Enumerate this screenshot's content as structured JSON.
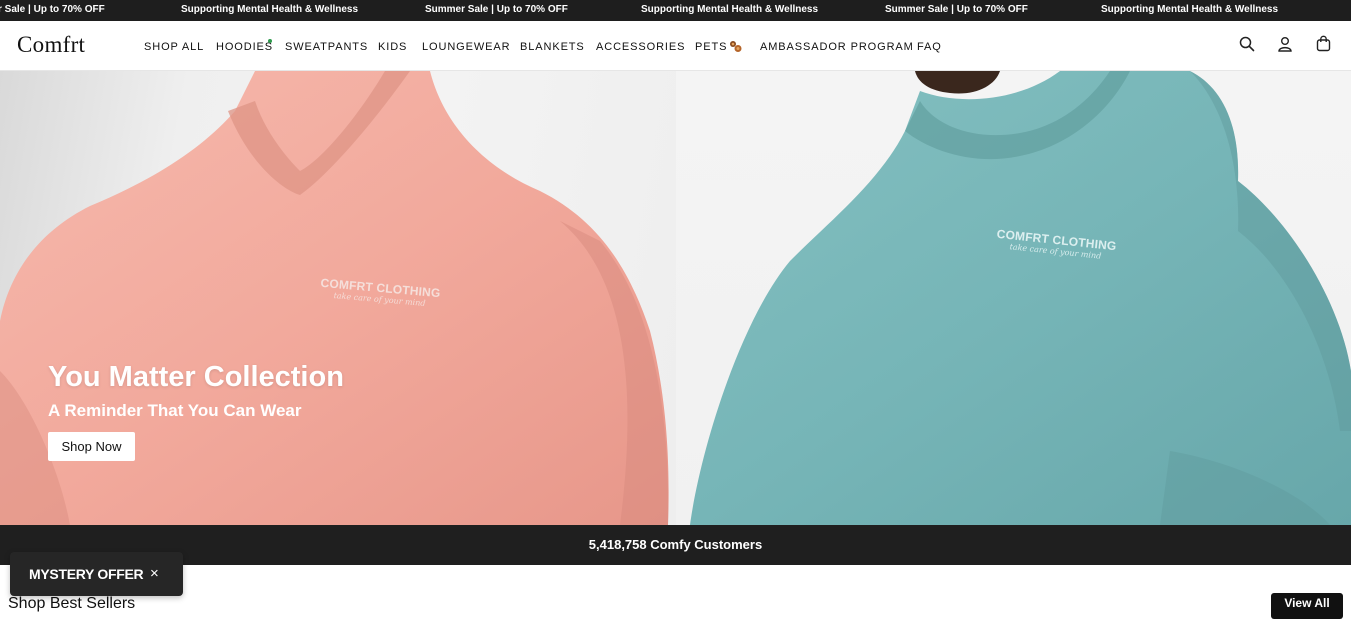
{
  "ticker": {
    "items": [
      "r Sale | Up to 70% OFF",
      "Supporting Mental Health & Wellness",
      "Summer Sale | Up to 70% OFF",
      "Supporting Mental Health & Wellness",
      "Summer Sale | Up to 70% OFF",
      "Supporting Mental Health & Wellness"
    ]
  },
  "header": {
    "logo": "Comfrt",
    "nav": [
      {
        "label": "SHOP ALL"
      },
      {
        "label": "HOODIES"
      },
      {
        "label": "SWEATPANTS"
      },
      {
        "label": "KIDS"
      },
      {
        "label": "LOUNGEWEAR"
      },
      {
        "label": "BLANKETS"
      },
      {
        "label": "ACCESSORIES"
      },
      {
        "label": "PETS"
      },
      {
        "label": "AMBASSADOR PROGRAM"
      },
      {
        "label": "FAQ"
      }
    ],
    "icons": [
      "search-icon",
      "account-icon",
      "cart-icon"
    ]
  },
  "hero": {
    "title": "You Matter Collection",
    "subtitle": "A Reminder That You Can Wear",
    "cta": "Shop Now",
    "print_left": {
      "brand": "COMFRT CLOTHING",
      "script": "take care of your mind"
    },
    "print_right": {
      "brand": "COMFRT CLOTHING",
      "script": "take care of your mind"
    },
    "colors": {
      "left_hoodie": "#f2aaa0",
      "right_hoodie": "#74b3b5"
    }
  },
  "stats": {
    "text": "5,418,758 Comfy Customers"
  },
  "popup": {
    "label": "MYSTERY OFFER",
    "close": "×"
  },
  "best_sellers": {
    "title": "Shop Best Sellers",
    "view_all": "View All"
  }
}
